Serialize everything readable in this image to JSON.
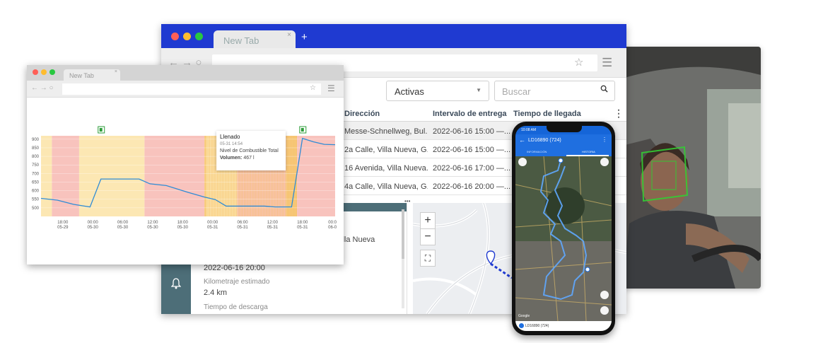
{
  "main_browser": {
    "tab_title": "New Tab",
    "tab_close": "×",
    "new_tab": "+",
    "nav": "← → ○",
    "star": "☆",
    "menu": "☰",
    "filter": {
      "selected": "Activas",
      "caret": "▼"
    },
    "search": {
      "placeholder": "Buscar"
    },
    "table": {
      "headers": [
        "Dirección",
        "Intervalo de entrega",
        "Tiempo de llegada"
      ],
      "kebab": "⋮",
      "rows": [
        [
          "Messe-Schnellweg, Bul...",
          "2022-06-16 15:00 —...",
          ""
        ],
        [
          "2a Calle, Villa Nueva, G...",
          "2022-06-16 15:00 —...",
          ""
        ],
        [
          "16 Avenida, Villa Nueva...",
          "2022-06-16 17:00 —...",
          ""
        ],
        [
          "4a Calle, Villa Nueva, G...",
          "2022-06-16 20:00 —...",
          ""
        ]
      ]
    },
    "detail": {
      "address_fragment": "illa Nueva",
      "time_value": "2022-06-16 20:00",
      "km_label": "Kilometraje estimado",
      "km_value": "2.4 km",
      "unload_label": "Tiempo de descarga"
    },
    "map_controls": {
      "zoom_in": "+",
      "zoom_out": "−",
      "fullscreen": "⛶",
      "more": "•••"
    },
    "sidebar_icon": "bell-icon"
  },
  "chart_browser": {
    "tab_title": "New Tab",
    "tab_close": "×",
    "nav": "← → ○",
    "star": "☆",
    "menu": "☰",
    "tooltip": {
      "title": "Llenado",
      "datetime": "05-31 14:54",
      "label": "Nivel de Combustible Total",
      "volume_label": "Volumen:",
      "volume_value": "467 l"
    }
  },
  "chart_data": {
    "type": "line",
    "title": "",
    "xlabel": "",
    "ylabel": "",
    "ylim": [
      450,
      920
    ],
    "y_ticks": [
      900,
      850,
      800,
      750,
      700,
      650,
      600,
      550,
      500
    ],
    "x_ticks": [
      {
        "time": "18:00",
        "date": "05-29"
      },
      {
        "time": "00:00",
        "date": "05-30"
      },
      {
        "time": "06:00",
        "date": "05-30"
      },
      {
        "time": "12:00",
        "date": "05-30"
      },
      {
        "time": "18:00",
        "date": "05-30"
      },
      {
        "time": "00:00",
        "date": "05-31"
      },
      {
        "time": "06:00",
        "date": "05-31"
      },
      {
        "time": "12:00",
        "date": "05-31"
      },
      {
        "time": "18:00",
        "date": "05-31"
      },
      {
        "time": "00:0",
        "date": "06-0"
      }
    ],
    "series": [
      {
        "name": "",
        "x": [
          0,
          3,
          6,
          9,
          11,
          13,
          15,
          18,
          20,
          23,
          26,
          27,
          30,
          32,
          34,
          36,
          38,
          40,
          41,
          43,
          46,
          48,
          50,
          52,
          54
        ],
        "y": [
          555,
          545,
          520,
          505,
          668,
          668,
          668,
          668,
          640,
          630,
          600,
          590,
          563,
          548,
          510,
          510,
          510,
          510,
          510,
          505,
          505,
          905,
          885,
          870,
          868
        ]
      }
    ],
    "fuel_markers": [
      {
        "x": 11,
        "label": "⛽"
      },
      {
        "x": 48,
        "label": "⛽"
      }
    ],
    "grid": true,
    "colors": {
      "line": "#2f8cd6",
      "band_red": "#f7b9b1",
      "band_yellow": "#fbe3a6",
      "band_orange": "#f6c067"
    }
  },
  "phone": {
    "status_time": "10:08 AM",
    "title": "LD16890 (724)",
    "tabs": [
      "INFORMACIÓN",
      "HISTORIA"
    ],
    "bottom_label": "LD16890 (724)",
    "google": "Google",
    "back": "←",
    "more": "⋮"
  },
  "colors": {
    "accent": "#1f3ad1",
    "panel": "#4d6e78",
    "face_box": "#33cc33"
  }
}
